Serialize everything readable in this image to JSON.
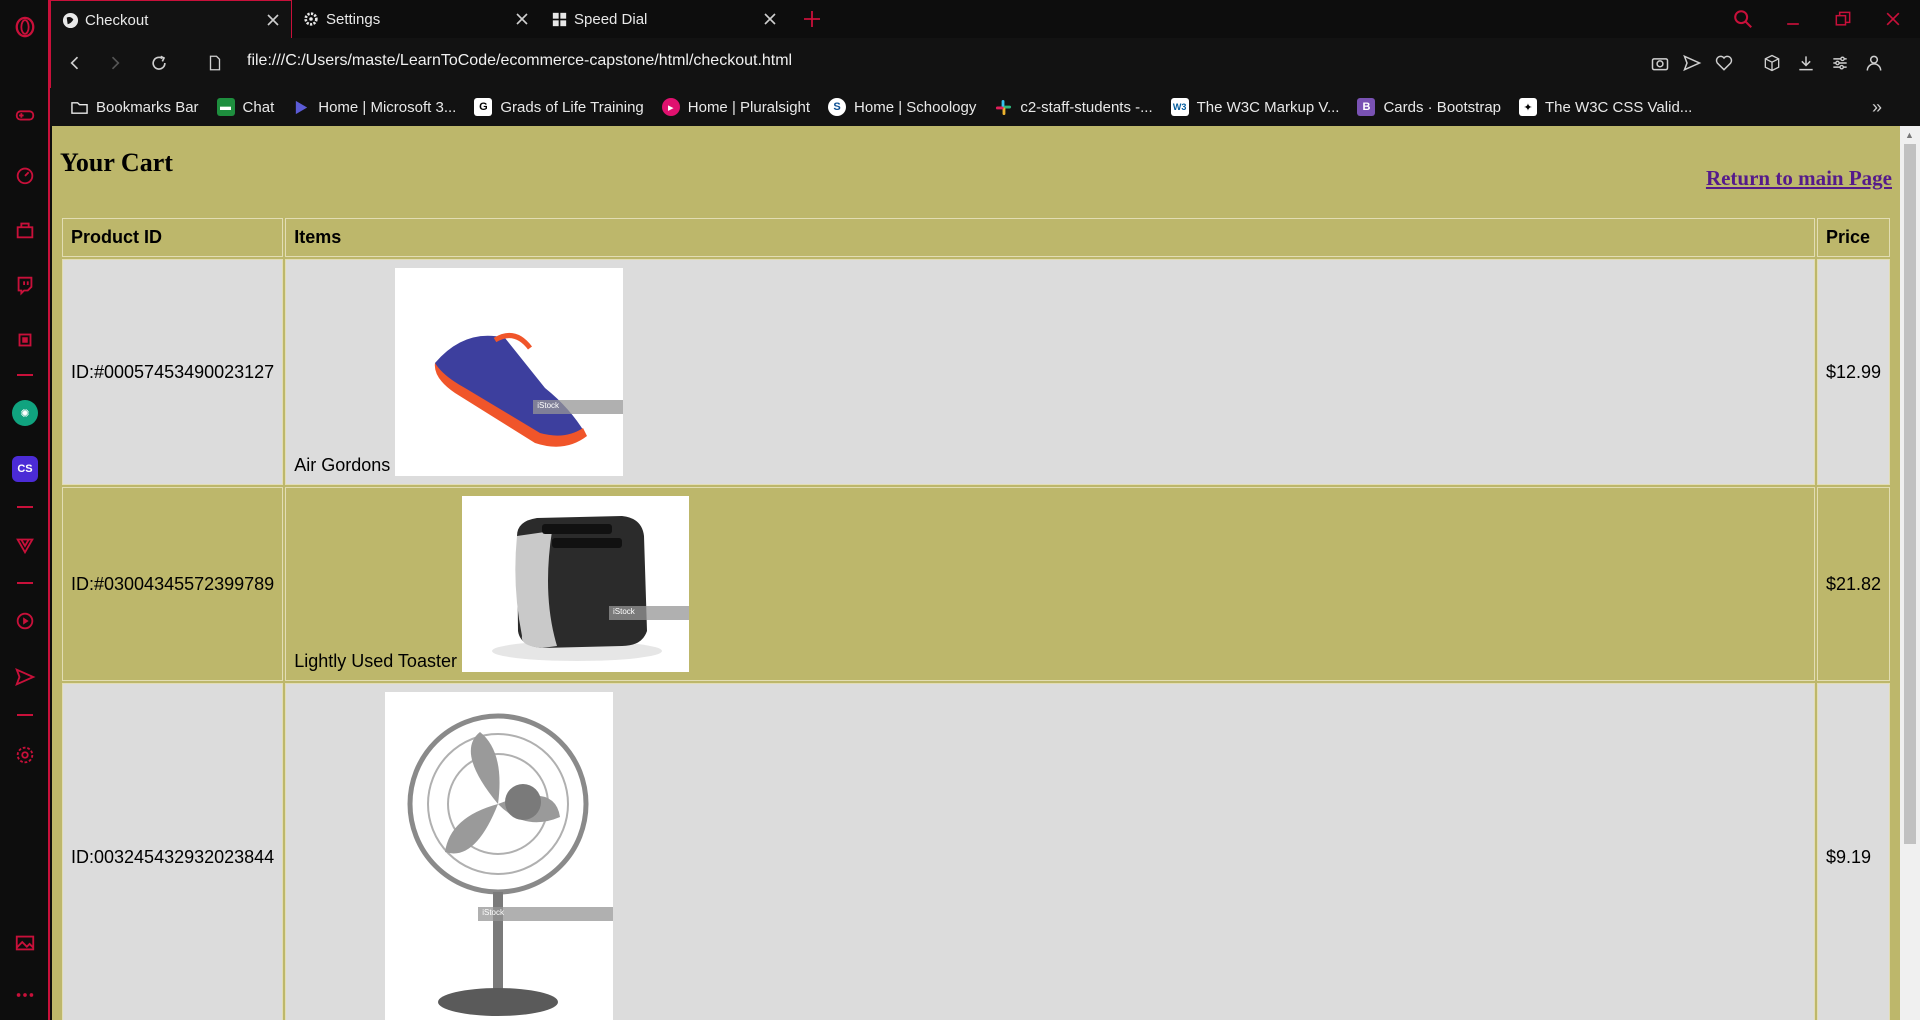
{
  "browser": {
    "tabs": [
      {
        "label": "Checkout",
        "active": true
      },
      {
        "label": "Settings",
        "active": false
      },
      {
        "label": "Speed Dial",
        "active": false
      }
    ],
    "url": "file:///C:/Users/maste/LearnToCode/ecommerce-capstone/html/checkout.html",
    "bookmarks": [
      {
        "label": "Bookmarks Bar",
        "icon": "folder-icon",
        "color": "#e8e8e8"
      },
      {
        "label": "Chat",
        "icon": "chat-icon",
        "color": "#1e8e3e"
      },
      {
        "label": "Home | Microsoft 3...",
        "icon": "microsoft-icon",
        "color": "#5b5bd6"
      },
      {
        "label": "Grads of Life Training",
        "icon": "g-icon",
        "color": "#ffffff"
      },
      {
        "label": "Home | Pluralsight",
        "icon": "pluralsight-icon",
        "color": "#e0116f"
      },
      {
        "label": "Home | Schoology",
        "icon": "schoology-icon",
        "color": "#ffffff"
      },
      {
        "label": "c2-staff-students -...",
        "icon": "slack-icon",
        "color": "#e01e5a"
      },
      {
        "label": "The W3C Markup V...",
        "icon": "w3c-icon",
        "color": "#ffffff"
      },
      {
        "label": "Cards · Bootstrap",
        "icon": "bootstrap-icon",
        "color": "#7952b3"
      },
      {
        "label": "The W3C CSS Valid...",
        "icon": "css-icon",
        "color": "#ffffff"
      }
    ],
    "accent": "#c8103a"
  },
  "page": {
    "title": "Your Cart",
    "return_link": "Return to main Page",
    "background": "#bdb76b",
    "table": {
      "headers": [
        "Product ID",
        "Items",
        "Price"
      ],
      "rows": [
        {
          "id": "ID:#00057453490023127",
          "item": "Air Gordons",
          "price": "$12.99",
          "image": "running-shoe-image"
        },
        {
          "id": "ID:#03004345572399789",
          "item": "Lightly Used Toaster",
          "price": "$21.82",
          "image": "toaster-image"
        },
        {
          "id": "ID:003245432932023844",
          "item": "",
          "price": "$9.19",
          "image": "desk-fan-image"
        }
      ]
    },
    "watermark": "iStock"
  }
}
